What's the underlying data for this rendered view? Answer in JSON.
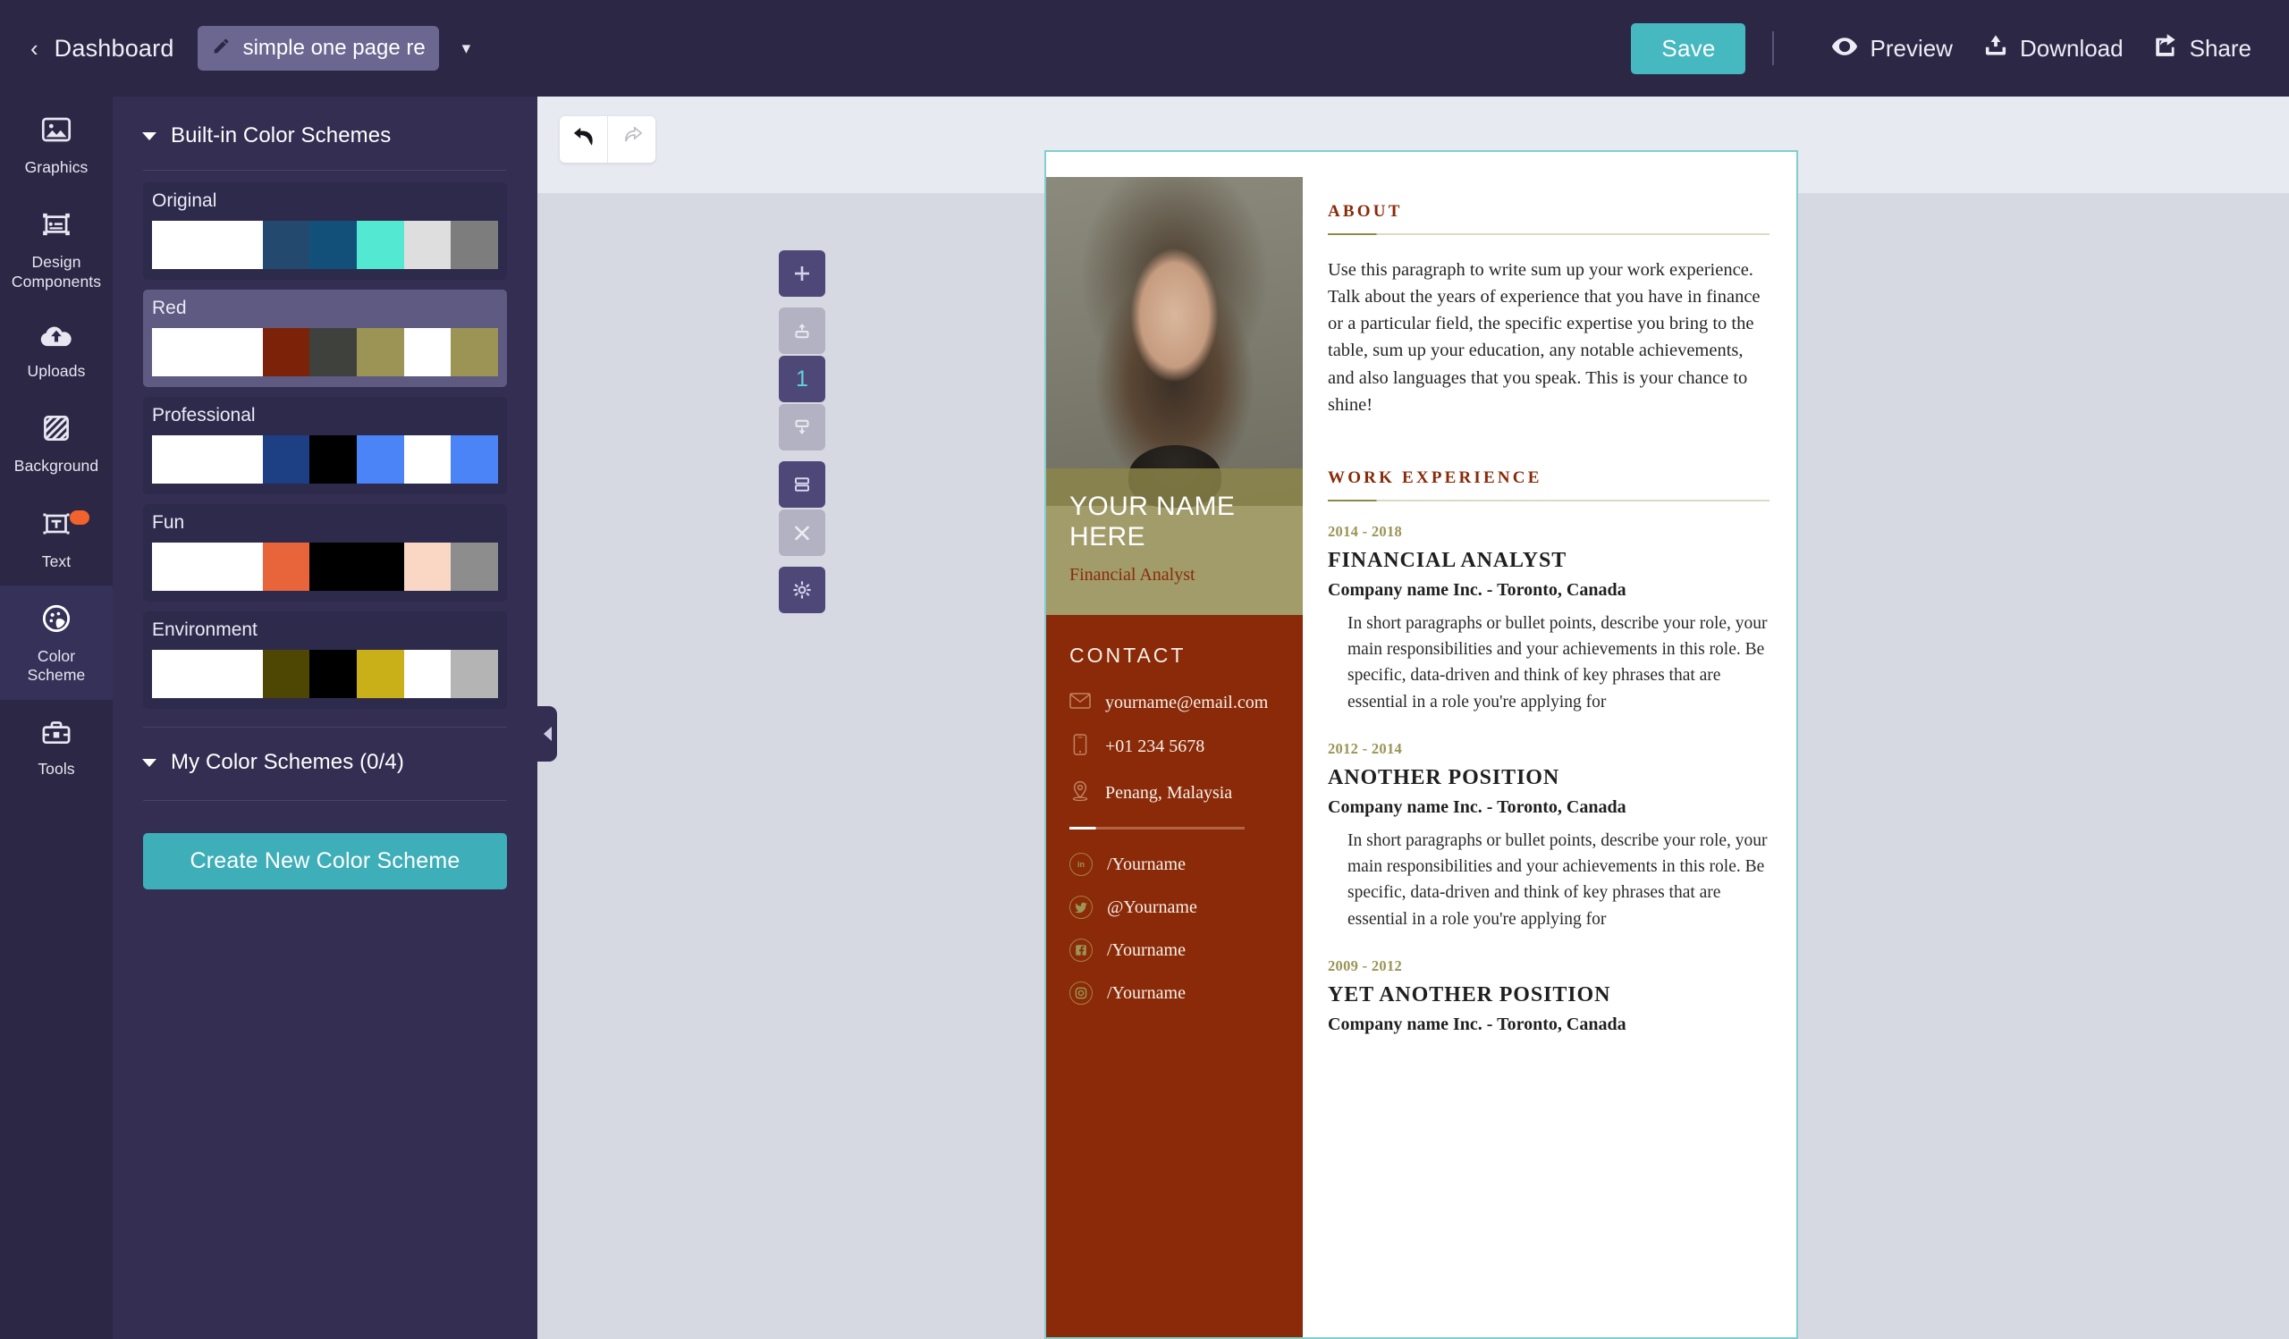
{
  "topbar": {
    "back_icon": "chevron-left-icon",
    "dashboard_label": "Dashboard",
    "doc_title": "simple one page resu",
    "doc_title_icon": "pencil-icon",
    "caret_icon": "chevron-down-icon",
    "save_label": "Save",
    "preview_label": "Preview",
    "download_label": "Download",
    "share_label": "Share",
    "accent_color": "#46b8c0",
    "bg_color": "#2b2745"
  },
  "rail": {
    "items": [
      {
        "label": "Graphics",
        "icon": "image-icon",
        "active": false,
        "badge": false
      },
      {
        "label": "Design\nComponents",
        "label_line1": "Design",
        "label_line2": "Components",
        "icon": "design-components-icon",
        "active": false,
        "badge": false
      },
      {
        "label": "Uploads",
        "icon": "cloud-upload-icon",
        "active": false,
        "badge": false
      },
      {
        "label": "Background",
        "icon": "background-hatch-icon",
        "active": false,
        "badge": false
      },
      {
        "label": "Text",
        "icon": "text-box-icon",
        "active": false,
        "badge": true
      },
      {
        "label": "Color\nScheme",
        "label_line1": "Color",
        "label_line2": "Scheme",
        "icon": "palette-icon",
        "active": true,
        "badge": false
      },
      {
        "label": "Tools",
        "icon": "toolbox-icon",
        "active": false,
        "badge": false
      }
    ]
  },
  "panel": {
    "builtin_header": "Built-in Color Schemes",
    "my_header": "My Color Schemes (0/4)",
    "create_button": "Create New Color Scheme",
    "create_button_color": "#3eafb8",
    "schemes": [
      {
        "name": "Original",
        "selected": false,
        "colors": [
          "#ffffff",
          "#234a6e",
          "#12507a",
          "#53e8d2",
          "#dededf",
          "#7d7d7d"
        ]
      },
      {
        "name": "Red",
        "selected": true,
        "colors": [
          "#ffffff",
          "#7b2208",
          "#3f413c",
          "#9b9454",
          "#ffffff",
          "#9b9454"
        ]
      },
      {
        "name": "Professional",
        "selected": false,
        "colors": [
          "#ffffff",
          "#1d3f84",
          "#000000",
          "#4b84f7",
          "#ffffff",
          "#4b84f7"
        ]
      },
      {
        "name": "Fun",
        "selected": false,
        "colors": [
          "#ffffff",
          "#e8643b",
          "#000000",
          "#000000",
          "#fad6c4",
          "#8d8d8d"
        ]
      },
      {
        "name": "Environment",
        "selected": false,
        "colors": [
          "#ffffff",
          "#4d4703",
          "#000000",
          "#c9b019",
          "#ffffff",
          "#b4b4b4"
        ]
      }
    ],
    "collapse_handle_icon": "triangle-left-icon"
  },
  "workspace": {
    "undo_icon": "undo-icon",
    "redo_icon": "redo-icon",
    "page_tools": [
      {
        "name": "add-page",
        "icon": "plus-icon",
        "state": "dark"
      },
      {
        "name": "move-page-up",
        "icon": "arrow-up-page-icon",
        "state": "muted"
      },
      {
        "name": "page-number",
        "icon": "",
        "state": "number",
        "value": "1"
      },
      {
        "name": "move-page-down",
        "icon": "arrow-down-page-icon",
        "state": "muted"
      },
      {
        "name": "duplicate-page",
        "icon": "duplicate-icon",
        "state": "dark"
      },
      {
        "name": "delete-page",
        "icon": "close-x-icon",
        "state": "muted"
      },
      {
        "name": "page-settings",
        "icon": "gear-icon",
        "state": "dark"
      }
    ],
    "canvas_border_color": "#7fd0cd"
  },
  "resume": {
    "name": "YOUR NAME HERE",
    "role": "Financial Analyst",
    "photo_alt": "portrait-photo",
    "contact": {
      "title": "CONTACT",
      "rows": [
        {
          "icon": "envelope-icon",
          "value": "yourname@email.com"
        },
        {
          "icon": "mobile-phone-icon",
          "value": "+01 234 5678"
        },
        {
          "icon": "location-pin-icon",
          "value": "Penang, Malaysia"
        }
      ],
      "socials": [
        {
          "icon": "linkedin-icon",
          "glyph": "in",
          "value": "/Yourname"
        },
        {
          "icon": "twitter-icon",
          "glyph": "t",
          "value": "@Yourname"
        },
        {
          "icon": "facebook-icon",
          "glyph": "f",
          "value": "/Yourname"
        },
        {
          "icon": "instagram-icon",
          "glyph": "o",
          "value": "/Yourname"
        }
      ]
    },
    "about": {
      "title": "ABOUT",
      "body": "Use this paragraph to write sum up your work experience. Talk about the years of experience that you have in finance or a particular field, the specific expertise you bring to the table, sum up your education, any notable achievements, and also languages that you speak. This is your chance to shine!"
    },
    "work": {
      "title": "WORK EXPERIENCE",
      "jobs": [
        {
          "dates": "2014 - 2018",
          "title": "FINANCIAL ANALYST",
          "company": "Company name Inc. - Toronto, Canada",
          "description": "In short paragraphs or bullet points, describe your role, your main responsibilities and your achievements in this role. Be specific, data-driven and think of key phrases that are essential in a role you're applying for"
        },
        {
          "dates": "2012 - 2014",
          "title": "ANOTHER POSITION",
          "company": "Company name Inc. - Toronto, Canada",
          "description": "In short paragraphs or bullet points, describe your role, your main responsibilities and your achievements in this role. Be specific, data-driven and think of key phrases that are essential in a role you're applying for"
        },
        {
          "dates": "2009 - 2012",
          "title": "YET ANOTHER POSITION",
          "company": "Company name Inc. - Toronto, Canada",
          "description": ""
        }
      ]
    },
    "theme": {
      "maroon": "#8a2a09",
      "olive": "#8c8649",
      "olive_text": "#9a9455"
    }
  }
}
